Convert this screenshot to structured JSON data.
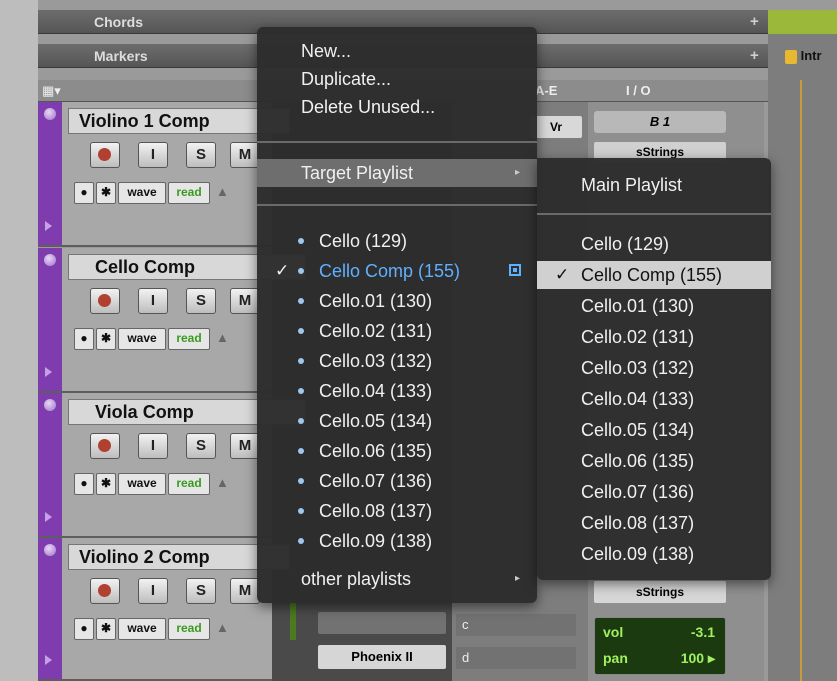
{
  "rulers": {
    "chords": "Chords",
    "markers": "Markers",
    "plus": "+"
  },
  "timeline": {
    "marker_label": "Intr"
  },
  "header": {
    "col_a": "A-E",
    "col_io": "I / O"
  },
  "tracks": [
    {
      "name": "Violino 1 Comp",
      "btn_i": "I",
      "btn_s": "S",
      "btn_m": "M",
      "view": "wave",
      "auto": "read"
    },
    {
      "name": "Cello Comp",
      "btn_i": "I",
      "btn_s": "S",
      "btn_m": "M",
      "view": "wave",
      "auto": "read"
    },
    {
      "name": "Viola Comp",
      "btn_i": "I",
      "btn_s": "S",
      "btn_m": "M",
      "view": "wave",
      "auto": "read"
    },
    {
      "name": "Violino 2 Comp",
      "btn_i": "I",
      "btn_s": "S",
      "btn_m": "M",
      "view": "wave",
      "auto": "read"
    }
  ],
  "io": {
    "output_b1": "B 1",
    "strings_top": "sStrings",
    "strings_bottom": "sStrings",
    "insert_top": "Vr",
    "slot_c": "c",
    "slot_d": "d",
    "plugin": "Phoenix II",
    "vol_label": "vol",
    "vol_value": "-3.1",
    "pan_label": "pan",
    "pan_value": "100 ▸"
  },
  "playlist_menu": {
    "new": "New...",
    "duplicate": "Duplicate...",
    "delete_unused": "Delete Unused...",
    "target_playlist": "Target Playlist",
    "items": [
      "Cello (129)",
      "Cello Comp (155)",
      "Cello.01 (130)",
      "Cello.02 (131)",
      "Cello.03 (132)",
      "Cello.04 (133)",
      "Cello.05 (134)",
      "Cello.06 (135)",
      "Cello.07 (136)",
      "Cello.08 (137)",
      "Cello.09 (138)"
    ],
    "other": "other playlists",
    "check": "✓"
  },
  "target_submenu": {
    "main": "Main Playlist",
    "items": [
      "Cello (129)",
      "Cello Comp (155)",
      "Cello.01 (130)",
      "Cello.02 (131)",
      "Cello.03 (132)",
      "Cello.04 (133)",
      "Cello.05 (134)",
      "Cello.06 (135)",
      "Cello.07 (136)",
      "Cello.08 (137)",
      "Cello.09 (138)"
    ],
    "check": "✓"
  },
  "colors": {
    "track_strip": "#7e3cae",
    "selected_playlist": "#5fb0ff",
    "highlight": "#d0d0d0"
  }
}
